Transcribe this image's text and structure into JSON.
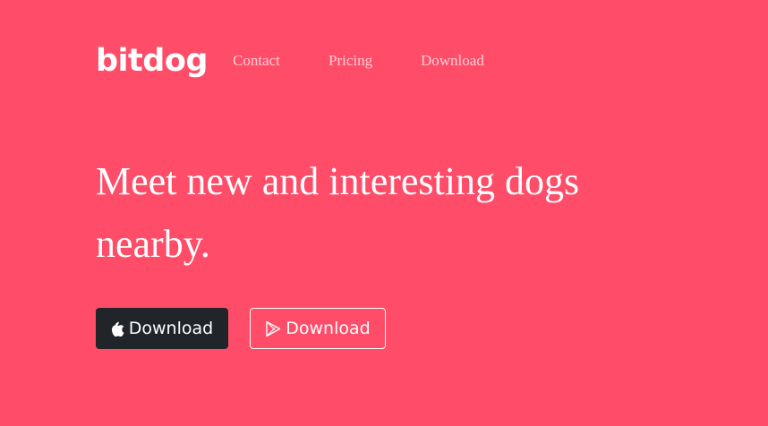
{
  "header": {
    "brand": "bitdog",
    "nav": [
      {
        "label": "Contact"
      },
      {
        "label": "Pricing"
      },
      {
        "label": "Download"
      }
    ]
  },
  "hero": {
    "headline": "Meet new and interesting dogs nearby.",
    "buttons": [
      {
        "label": "Download",
        "icon": "apple-icon",
        "style": "dark"
      },
      {
        "label": "Download",
        "icon": "google-play-icon",
        "style": "outline"
      }
    ]
  },
  "colors": {
    "background": "#ff4c68",
    "dark_button": "#212529",
    "text": "#ffffff"
  }
}
